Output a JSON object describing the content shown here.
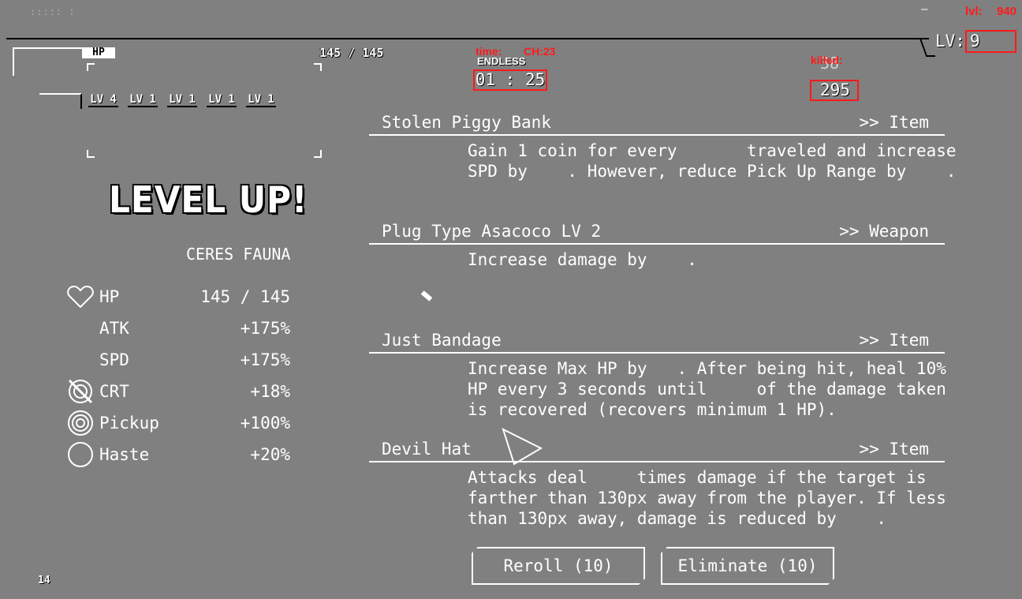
{
  "top": {
    "faded_label": "::::: :",
    "hp_label": "HP",
    "hp_value": "145 / 145",
    "mode": "ENDLESS",
    "timer": "01 : 25",
    "kill_value": "295",
    "kill_faded": "38",
    "lv_label": "LV:",
    "lv_value": "9",
    "debug_time_label": "time:",
    "debug_ch_label": "CH:23",
    "debug_killed_label": "killed:",
    "debug_lvl_label": "lvl:",
    "debug_lvl_value": "940",
    "dash": "—"
  },
  "weapon_slots": [
    "LV 4",
    "LV 1",
    "LV 1",
    "LV 1",
    "LV 1"
  ],
  "level_up_title": "LEVEL UP!",
  "character_name": "CERES FAUNA",
  "stats": [
    {
      "label": "HP",
      "value": "145 / 145",
      "icon": "heart-icon"
    },
    {
      "label": "ATK",
      "value": "+175%",
      "icon": ""
    },
    {
      "label": "SPD",
      "value": "+175%",
      "icon": ""
    },
    {
      "label": "CRT",
      "value": "+18%",
      "icon": "crit-target-icon"
    },
    {
      "label": "Pickup",
      "value": "+100%",
      "icon": "pickup-rings-icon"
    },
    {
      "label": "Haste",
      "value": "+20%",
      "icon": "haste-circle-icon"
    }
  ],
  "choices": [
    {
      "name": "Stolen Piggy Bank",
      "type": ">> Item",
      "desc": "Gain 1 coin for every       traveled and increase\nSPD by    . However, reduce Pick Up Range by    ."
    },
    {
      "name": "Plug Type Asacoco LV 2",
      "type": ">> Weapon",
      "desc": "Increase damage by    ."
    },
    {
      "name": "Just Bandage",
      "type": ">> Item",
      "desc": "Increase Max HP by   . After being hit, heal 10%\nHP every 3 seconds until     of the damage taken\nis recovered (recovers minimum 1 HP)."
    },
    {
      "name": "Devil Hat",
      "type": ">> Item",
      "desc": "Attacks deal     times damage if the target is\nfarther than 130px away from the player. If less\nthan 130px away, damage is reduced by    ."
    }
  ],
  "buttons": {
    "reroll": "Reroll (10)",
    "eliminate": "Eliminate (10)"
  },
  "footer_number": "14"
}
